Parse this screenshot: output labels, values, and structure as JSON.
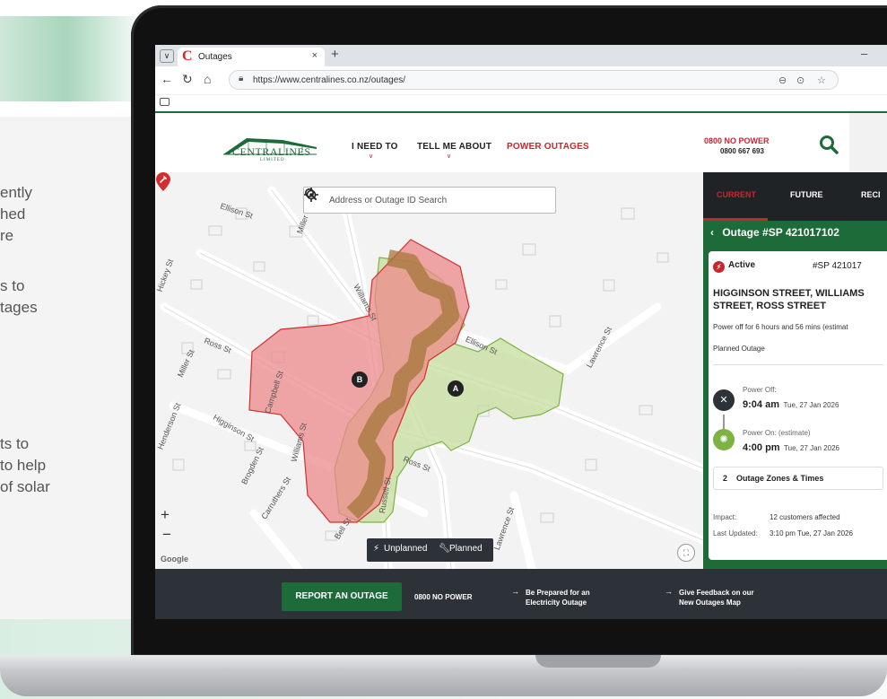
{
  "side_text": [
    "ently",
    "hed",
    "re",
    "s to",
    "tages",
    "ts to",
    "to help",
    "of solar"
  ],
  "browser": {
    "tab_title": "Outages",
    "tab_close": "×",
    "new_tab": "+",
    "minimize": "–",
    "url": "https://www.centralines.co.nz/outages/"
  },
  "site": {
    "logo_text": "CENTRALINES",
    "logo_sub": "LIMITED",
    "nav": [
      {
        "label": "I NEED TO",
        "has_dropdown": true
      },
      {
        "label": "TELL ME ABOUT",
        "has_dropdown": true
      },
      {
        "label": "POWER OUTAGES",
        "has_dropdown": false
      }
    ],
    "phone_line1": "0800 NO POWER",
    "phone_line2": "0800 667 693",
    "brand_green": "#1e6b3a",
    "brand_red": "#c8262d"
  },
  "map": {
    "search_placeholder": "Address or Outage ID Search",
    "streets": [
      "Ellison St",
      "Miller St",
      "Hickey St",
      "Ross St",
      "Miller St",
      "Williams St",
      "Ellison St",
      "Lawrence St",
      "Higginson St",
      "Campbell St",
      "Henderson St",
      "Brogden St",
      "Williams St",
      "Ross St",
      "Carruthers St",
      "Russell St",
      "Bell St",
      "Lawrence St"
    ],
    "zone_markers": [
      "A",
      "B"
    ],
    "zoom_in": "+",
    "zoom_out": "−",
    "google_label": "Google",
    "legend": {
      "unplanned": "Unplanned",
      "planned": "Planned"
    },
    "planned_color": "#8bc34a",
    "unplanned_color": "#e57373"
  },
  "panel": {
    "tabs": [
      {
        "label": "CURRENT",
        "active": true
      },
      {
        "label": "FUTURE",
        "active": false
      },
      {
        "label": "RECI",
        "active": false
      }
    ],
    "outage_title": "Outage #SP 421017102",
    "back_icon": "chevron-left-icon",
    "status": "Active",
    "id_short": "#SP 421017",
    "streets": "HIGGINSON STREET, WILLIAMS STREET, ROSS STREET",
    "duration": "Power off for 6 hours and 56 mins (estimat",
    "type": "Planned Outage",
    "power_off": {
      "label": "Power Off:",
      "time": "9:04 am",
      "date": "Tue, 27 Jan 2026"
    },
    "power_on": {
      "label": "Power On: (estimate)",
      "time": "4:00 pm",
      "date": "Tue, 27 Jan 2026"
    },
    "zones": {
      "count": "2",
      "label": "Outage Zones & Times"
    },
    "impact": {
      "key": "Impact:",
      "value": "12 customers affected"
    },
    "last_updated": {
      "key": "Last Updated:",
      "value": "3:10 pm Tue, 27 Jan 2026"
    }
  },
  "footer": {
    "report_button": "REPORT AN OUTAGE",
    "phone": "0800 NO POWER",
    "link1_line1": "Be Prepared for an",
    "link1_line2": "Electricity Outage",
    "link2_line1": "Give Feedback on our",
    "link2_line2": "New Outages Map",
    "arrow": "→"
  }
}
